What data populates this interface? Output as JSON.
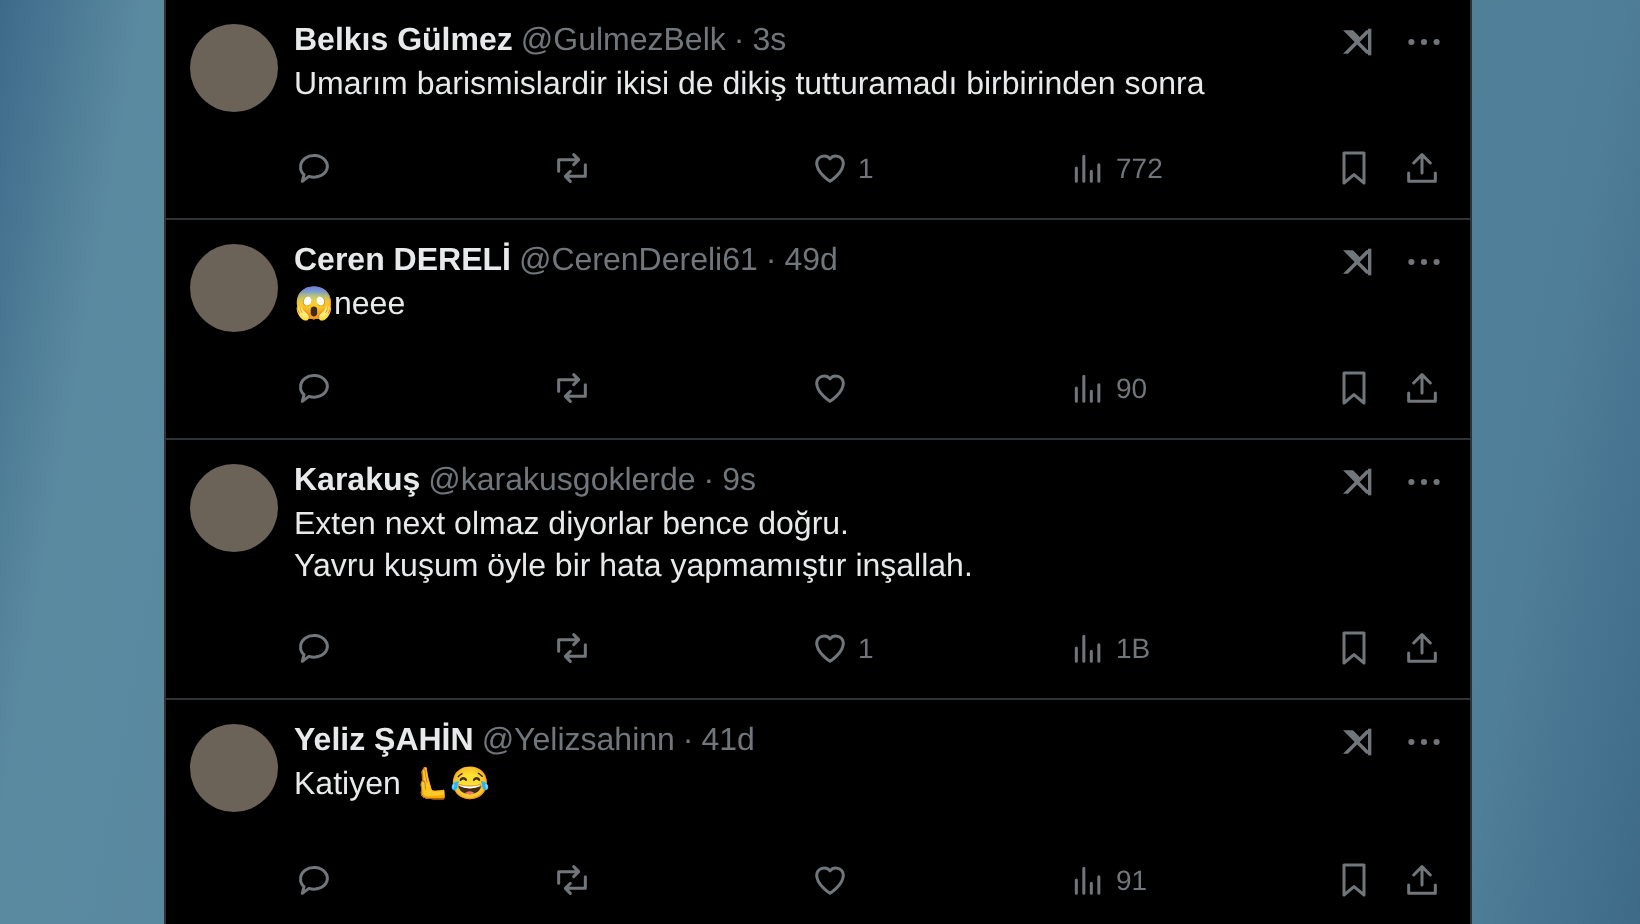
{
  "tweets": [
    {
      "name": "Belkıs Gülmez",
      "handle": "@GulmezBelk",
      "sep": "·",
      "time": "3s",
      "lines": [
        "Umarım barismislardir ikisi de dikiş tutturamadı birbirinden sonra"
      ],
      "likes": "1",
      "views": "772"
    },
    {
      "name": "Ceren DERELİ",
      "handle": "@CerenDereli61",
      "sep": "·",
      "time": "49d",
      "lines": [
        "😱neee"
      ],
      "views": "90"
    },
    {
      "name": "Karakuş",
      "handle": "@karakusgoklerde",
      "sep": "·",
      "time": "9s",
      "lines": [
        "Exten next olmaz diyorlar bence doğru.",
        "Yavru kuşum öyle bir hata yapmamıştır inşallah."
      ],
      "likes": "1",
      "views": "1B"
    },
    {
      "name": "Yeliz ŞAHİN",
      "handle": "@Yelizsahinn",
      "sep": "·",
      "time": "41d",
      "lines": [
        "Katiyen 🫷😂"
      ],
      "views": "91"
    }
  ]
}
